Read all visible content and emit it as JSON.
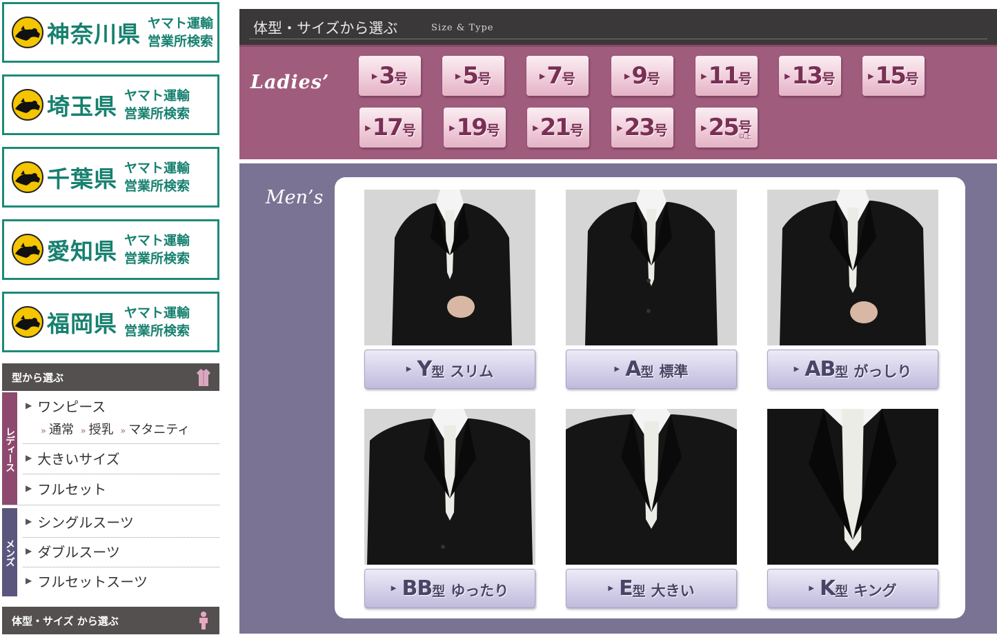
{
  "sidebar": {
    "yamato_banners": [
      {
        "pref": "神奈川県",
        "line1": "ヤマト運輸",
        "line2": "営業所検索"
      },
      {
        "pref": "埼玉県",
        "line1": "ヤマト運輸",
        "line2": "営業所検索"
      },
      {
        "pref": "千葉県",
        "line1": "ヤマト運輸",
        "line2": "営業所検索"
      },
      {
        "pref": "愛知県",
        "line1": "ヤマト運輸",
        "line2": "営業所検索"
      },
      {
        "pref": "福岡県",
        "line1": "ヤマト運輸",
        "line2": "営業所検索"
      }
    ],
    "type_section": {
      "title": "型から選ぶ",
      "ladies_tab": "レディース",
      "ladies_items": [
        "ワンピース",
        "大きいサイズ",
        "フルセット"
      ],
      "onepiece_sub": [
        "通常",
        "授乳",
        "マタニティ"
      ],
      "mens_tab": "メンズ",
      "mens_items": [
        "シングルスーツ",
        "ダブルスーツ",
        "フルセットスーツ"
      ]
    },
    "size_section": {
      "title": "体型・サイズ から選ぶ"
    },
    "colors": {
      "yamato_green": "#1c8a78",
      "header_gray": "#545050",
      "ladies_accent": "#8e4a6e",
      "mens_accent": "#5a567e"
    }
  },
  "main": {
    "title": "体型・サイズから選ぶ",
    "subtitle": "Size & Type",
    "ladies": {
      "label": "Ladies’",
      "sizes": [
        {
          "num": "3",
          "unit": "号"
        },
        {
          "num": "5",
          "unit": "号"
        },
        {
          "num": "7",
          "unit": "号"
        },
        {
          "num": "9",
          "unit": "号"
        },
        {
          "num": "11",
          "unit": "号"
        },
        {
          "num": "13",
          "unit": "号"
        },
        {
          "num": "15",
          "unit": "号"
        },
        {
          "num": "17",
          "unit": "号"
        },
        {
          "num": "19",
          "unit": "号"
        },
        {
          "num": "21",
          "unit": "号"
        },
        {
          "num": "23",
          "unit": "号"
        },
        {
          "num": "25",
          "unit": "号",
          "note": "以上"
        }
      ]
    },
    "mens": {
      "label": "Men’s",
      "types": [
        {
          "code": "Y",
          "kata": "型",
          "desc": "スリム"
        },
        {
          "code": "A",
          "kata": "型",
          "desc": "標準"
        },
        {
          "code": "AB",
          "kata": "型",
          "desc": "がっしり"
        },
        {
          "code": "BB",
          "kata": "型",
          "desc": "ゆったり"
        },
        {
          "code": "E",
          "kata": "型",
          "desc": "大きい"
        },
        {
          "code": "K",
          "kata": "型",
          "desc": "キング"
        }
      ]
    },
    "colors": {
      "header_bg": "#3a3838",
      "ladies_bg": "#a05c7d",
      "mens_bg": "#7a7394"
    }
  }
}
